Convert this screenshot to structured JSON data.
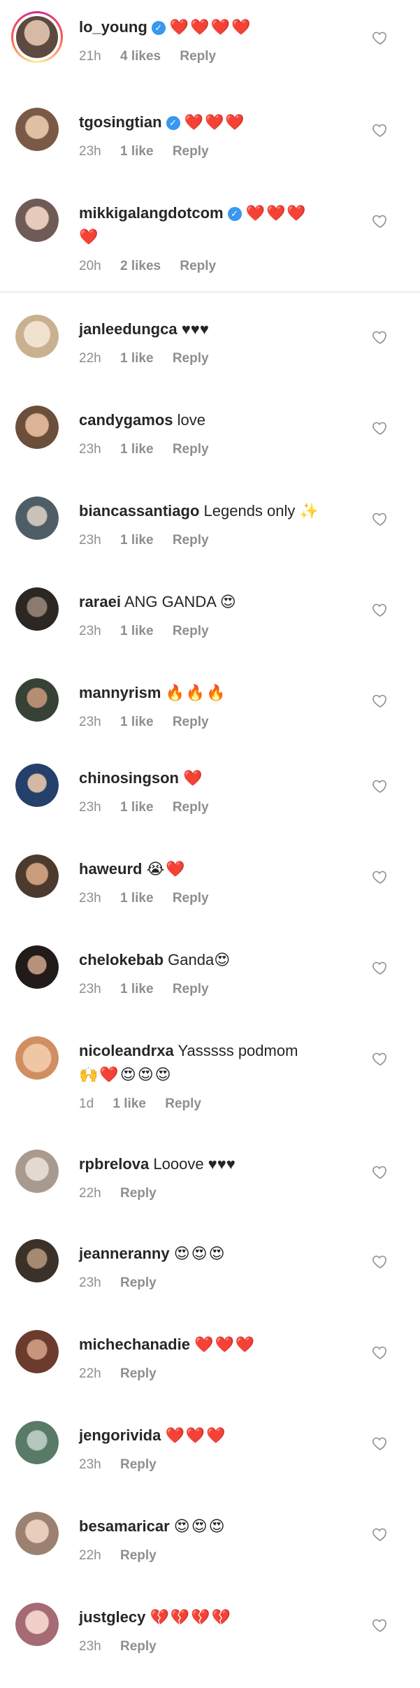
{
  "comments": [
    {
      "username": "lo_young",
      "verified": true,
      "text": "",
      "emojis": "❤️❤️❤️❤️",
      "time": "21h",
      "likes": "4 likes",
      "reply": "Reply",
      "avatar_color": "#6b5a4e"
    },
    {
      "username": "tgosingtian",
      "verified": true,
      "text": "",
      "emojis": "❤️❤️❤️",
      "time": "23h",
      "likes": "1 like",
      "reply": "Reply",
      "avatar_color": "#7a5a46"
    },
    {
      "username": "mikkigalangdotcom",
      "verified": true,
      "text": "",
      "emojis": "❤️❤️❤️",
      "emojis2": "❤️",
      "time": "20h",
      "likes": "2 likes",
      "reply": "Reply",
      "avatar_color": "#8d7a74"
    },
    {
      "username": "janleedungca",
      "verified": false,
      "text": "♥♥♥",
      "emojis": "",
      "time": "22h",
      "likes": "1 like",
      "reply": "Reply",
      "avatar_color": "#d9c7a7"
    },
    {
      "username": "candygamos",
      "verified": false,
      "text": "love",
      "emojis": "",
      "time": "23h",
      "likes": "1 like",
      "reply": "Reply",
      "avatar_color": "#a67f5e"
    },
    {
      "username": "biancassantiago",
      "verified": false,
      "text": "Legends only",
      "emojis": "✨",
      "time": "23h",
      "likes": "1 like",
      "reply": "Reply",
      "avatar_color": "#5a6b78"
    },
    {
      "username": "raraei",
      "verified": false,
      "text": "ANG GANDA",
      "emojis": "😍",
      "time": "23h",
      "likes": "1 like",
      "reply": "Reply",
      "avatar_color": "#3d3530"
    },
    {
      "username": "mannyrism",
      "verified": false,
      "text": "",
      "emojis": "🔥🔥🔥",
      "time": "23h",
      "likes": "1 like",
      "reply": "Reply",
      "avatar_color": "#3f4a40"
    },
    {
      "username": "chinosingson",
      "verified": false,
      "text": "",
      "emojis": "❤️",
      "time": "23h",
      "likes": "1 like",
      "reply": "Reply",
      "avatar_color": "#2f4a73"
    },
    {
      "username": "haweurd",
      "verified": false,
      "text": "",
      "emojis": "😭❤️",
      "time": "23h",
      "likes": "1 like",
      "reply": "Reply",
      "avatar_color": "#5b4636"
    },
    {
      "username": "chelokebab",
      "verified": false,
      "text": "Ganda",
      "emojis": "😍",
      "time": "23h",
      "likes": "1 like",
      "reply": "Reply",
      "avatar_color": "#2e2623"
    },
    {
      "username": "nicoleandrxa",
      "verified": false,
      "text": "Yasssss podmom",
      "emojis": "",
      "emojis2": "🙌❤️😍😍😍",
      "time": "1d",
      "likes": "1 like",
      "reply": "Reply",
      "avatar_color": "#d8a27a"
    },
    {
      "username": "rpbrelova",
      "verified": false,
      "text": "Looove ♥♥♥",
      "emojis": "",
      "time": "22h",
      "likes": "",
      "reply": "Reply",
      "avatar_color": "#c9c1ba"
    },
    {
      "username": "jeanneranny",
      "verified": false,
      "text": "",
      "emojis": "😍😍😍",
      "time": "23h",
      "likes": "",
      "reply": "Reply",
      "avatar_color": "#4f4235"
    },
    {
      "username": "michechanadie",
      "verified": false,
      "text": "",
      "emojis": "❤️❤️❤️",
      "time": "22h",
      "likes": "",
      "reply": "Reply",
      "avatar_color": "#7b4b3c"
    },
    {
      "username": "jengorivida",
      "verified": false,
      "text": "",
      "emojis": "❤️❤️❤️",
      "time": "23h",
      "likes": "",
      "reply": "Reply",
      "avatar_color": "#6e8a7a"
    },
    {
      "username": "besamaricar",
      "verified": false,
      "text": "",
      "emojis": "😍😍😍",
      "time": "22h",
      "likes": "",
      "reply": "Reply",
      "avatar_color": "#b39a8c"
    },
    {
      "username": "justglecy",
      "verified": false,
      "text": "",
      "emojis": "💔💔💔💔",
      "time": "23h",
      "likes": "",
      "reply": "Reply",
      "avatar_color": "#b27b86"
    }
  ]
}
